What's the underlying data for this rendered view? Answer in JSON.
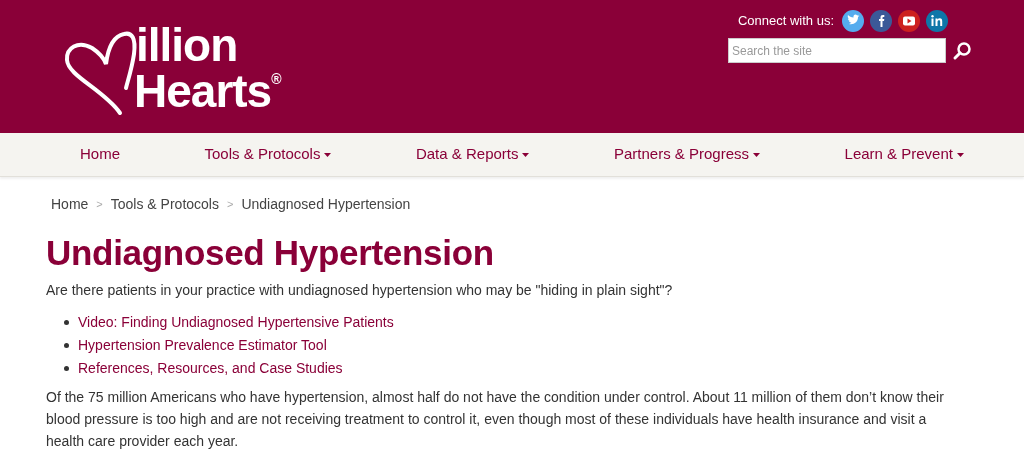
{
  "header": {
    "logo": {
      "line_1": "illion",
      "line_2": "Hearts",
      "mark": "®"
    },
    "connect_label": "Connect with us:",
    "social": [
      {
        "kind": "twitter",
        "color": "#55acee"
      },
      {
        "kind": "facebook",
        "color": "#3b5998"
      },
      {
        "kind": "youtube",
        "color": "#cd201f"
      },
      {
        "kind": "linkedin",
        "color": "#0e76a8"
      }
    ],
    "search": {
      "placeholder": "Search the site"
    }
  },
  "nav": [
    {
      "label": "Home",
      "has_menu": false
    },
    {
      "label": "Tools & Protocols",
      "has_menu": true
    },
    {
      "label": "Data & Reports",
      "has_menu": true
    },
    {
      "label": "Partners & Progress",
      "has_menu": true
    },
    {
      "label": "Learn & Prevent",
      "has_menu": true
    }
  ],
  "breadcrumb": [
    {
      "label": "Home",
      "separator": ">"
    },
    {
      "label": "Tools & Protocols",
      "separator": ">"
    },
    {
      "label": "Undiagnosed Hypertension"
    }
  ],
  "title": "Undiagnosed Hypertension",
  "intro": "Are there patients in your practice with undiagnosed hypertension who may be \"hiding in plain sight\"?",
  "links": [
    "Video: Finding Undiagnosed Hypertensive Patients",
    "Hypertension Prevalence Estimator Tool",
    "References, Resources, and Case Studies"
  ],
  "body": "Of the 75 million Americans who have hypertension, almost half do not have the condition under control. About 11 million of them don’t know their blood pressure is too high and are not receiving treatment to control it, even though most of these individuals have health insurance and visit a health care provider each year."
}
